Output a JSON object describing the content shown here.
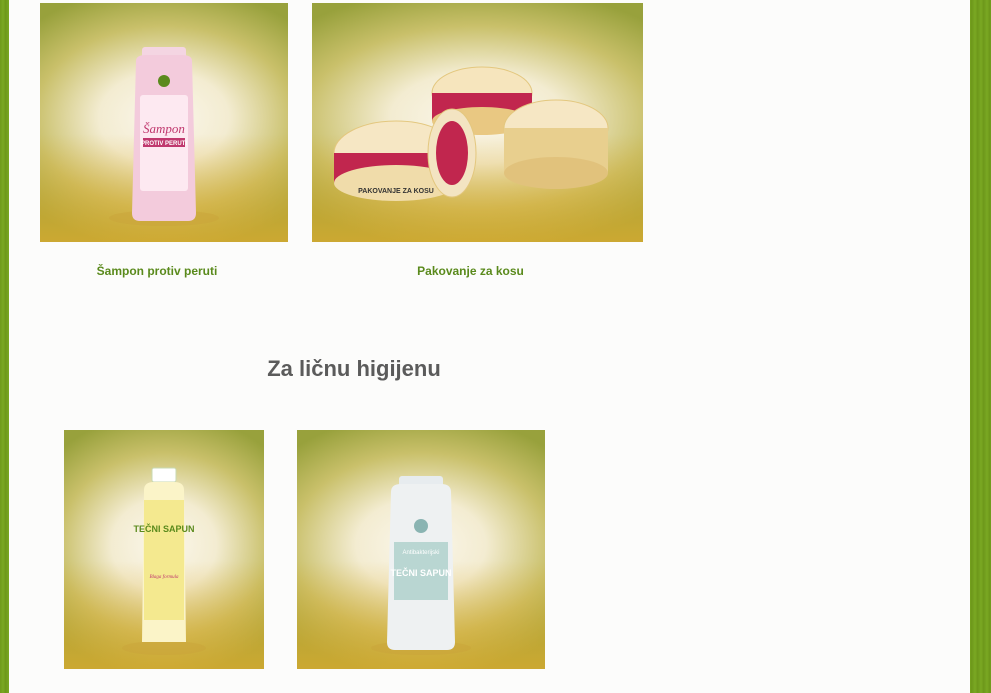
{
  "products_top": [
    {
      "name": "Šampon protiv peruti",
      "label": "Šampon",
      "sublabel": "PROTIV PERUTI"
    },
    {
      "name": "Pakovanje za kosu",
      "label": "PAKOVANJE ZA KOSU"
    }
  ],
  "section": {
    "title": "Za ličnu higijenu"
  },
  "products_bottom": [
    {
      "label": "TEČNI SAPUN",
      "sublabel": "Blaga formula"
    },
    {
      "label": "TEČNI SAPUN",
      "sublabel": "Antibakterijski"
    }
  ]
}
